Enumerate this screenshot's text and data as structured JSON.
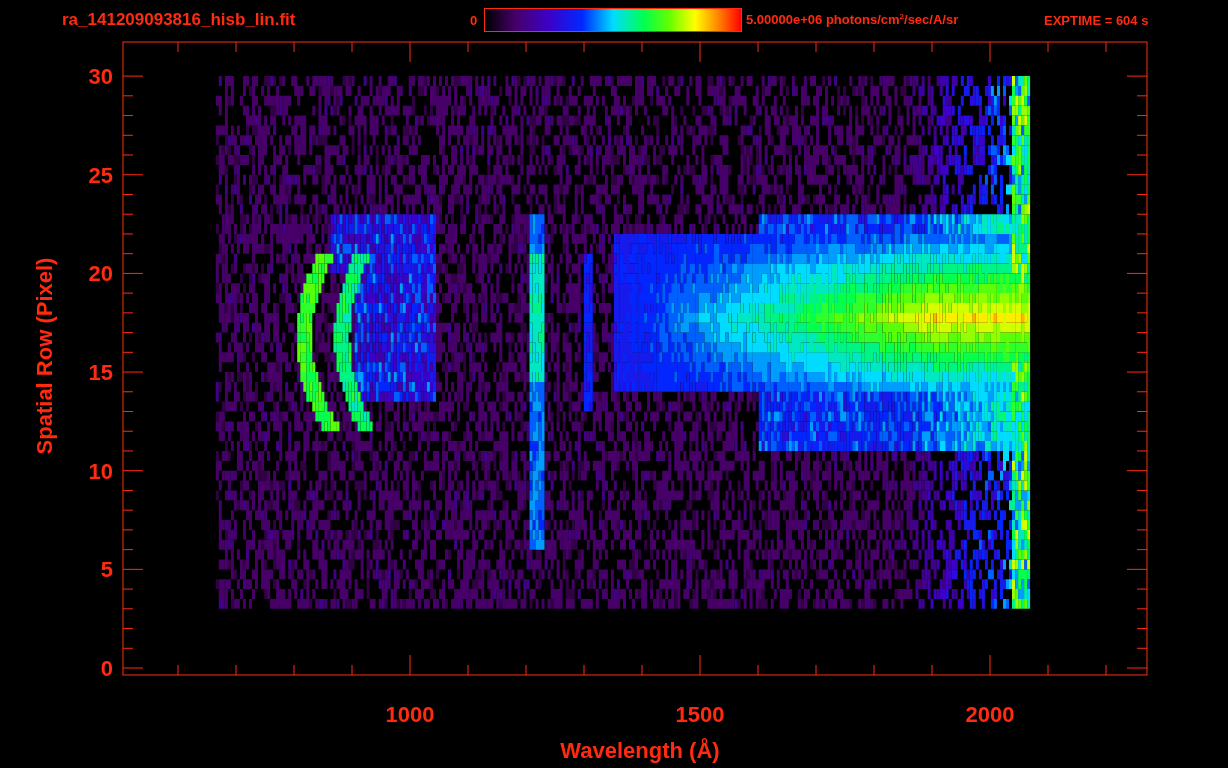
{
  "title": "ra_141209093816_hisb_lin.fit",
  "colorbar": {
    "min_label": "0",
    "max_label": "5.00000e+06 photons/cm$^{2}$/sec/A/sr"
  },
  "exptime": "EXPTIME = 604 s",
  "plot": {
    "xlabel": "Wavelength (Å)",
    "ylabel": "Spatial Row (Pixel)",
    "xticks": [
      "1000",
      "1500",
      "2000"
    ],
    "yticks": [
      "30",
      "25",
      "20",
      "15",
      "10",
      "5",
      "0"
    ]
  }
}
